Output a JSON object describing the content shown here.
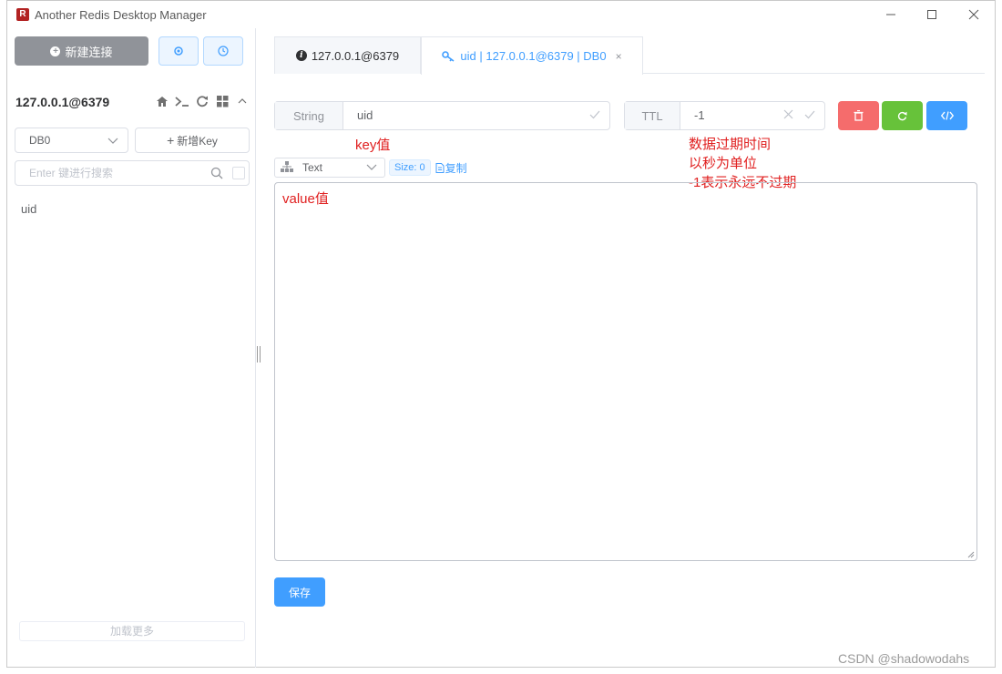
{
  "window": {
    "title": "Another Redis Desktop Manager",
    "icon": "app-logo-icon"
  },
  "sidebar": {
    "new_connection_label": "新建连接",
    "connection_name": "127.0.0.1@6379",
    "db_select": "DB0",
    "add_key_label": "新增Key",
    "search_placeholder": "Enter 键进行搜索",
    "keys": [
      "uid"
    ],
    "load_more_label": "加载更多"
  },
  "tabs": [
    {
      "label": "127.0.0.1@6379",
      "icon": "info-icon",
      "active": false
    },
    {
      "label": "uid | 127.0.0.1@6379 | DB0",
      "icon": "key-icon",
      "active": true
    }
  ],
  "editor": {
    "type_label": "String",
    "key_value": "uid",
    "ttl_label": "TTL",
    "ttl_value": "-1",
    "format_select": "Text",
    "size_tag": "Size: 0",
    "copy_label": "复制",
    "save_label": "保存",
    "value": ""
  },
  "annotations": {
    "key_note": "key值",
    "ttl_note_1": "数据过期时间",
    "ttl_note_2": "以秒为单位",
    "ttl_note_3": "-1表示永远不过期",
    "value_note": "value值"
  },
  "colors": {
    "primary": "#409eff",
    "danger": "#f56c6c",
    "success": "#67c23a",
    "info": "#909399",
    "annotation": "#e02020"
  },
  "watermark": "CSDN @shadowodahs"
}
